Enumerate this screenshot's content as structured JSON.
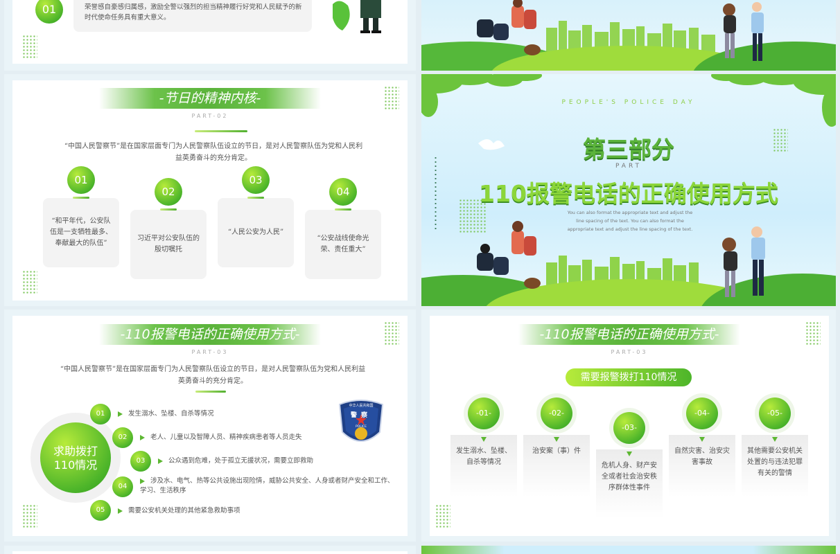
{
  "slide1": {
    "number": "01",
    "text": "对于推动人民警察队伍革命化正规化专业化职业化建设，增强广大民警职业荣誉感自豪感归属感，激励全警以强烈的担当精神履行好党和人民赋予的新时代使命任务具有重大意义。"
  },
  "slide3": {
    "title": "-节日的精神内核-",
    "part": "PART-02",
    "intro": "“中国人民警察节”是在国家层面专门为人民警察队伍设立的节日，是对人民警察队伍为党和人民利益英勇奋斗的充分肯定。",
    "items": [
      {
        "num": "01",
        "text": "“和平年代，公安队伍是一支牺牲最多、奉献最大的队伍”"
      },
      {
        "num": "02",
        "text": "习近平对公安队伍的殷切嘱托"
      },
      {
        "num": "03",
        "text": "“人民公安为人民”"
      },
      {
        "num": "04",
        "text": "“公安战线使命光荣、责任重大”"
      }
    ]
  },
  "slide4": {
    "eyebrow": "PEOPLE'S POLICE DAY",
    "heading": "第三部分",
    "part": "PART",
    "title": "110报警电话的正确使用方式",
    "desc": "You can also format the appropriate text and adjust the line spacing of the text. You can also format the appropriate text and adjust the line spacing of the text."
  },
  "slide5": {
    "title": "-110报警电话的正确使用方式-",
    "part": "PART-03",
    "intro": "“中国人民警察节”是在国家层面专门为人民警察队伍设立的节日，是对人民警察队伍为党和人民利益英勇奋斗的充分肯定。",
    "center_line1": "求助拨打",
    "center_line2": "110情况",
    "badge_top": "中华人民共和国",
    "badge_mid": "警察",
    "badge_bottom": "POLICE",
    "items": [
      {
        "num": "01",
        "text": "发生溺水、坠楼、自杀等情况"
      },
      {
        "num": "02",
        "text": "老人、儿童以及智障人员、精神疾病患者等人员走失"
      },
      {
        "num": "03",
        "text": "公众遇到危难，处于孤立无援状况，需要立即救助"
      },
      {
        "num": "04",
        "text": "涉及水、电气、热等公共设施出现险情，威胁公共安全、人身或者财产安全和工作、学习、生活秩序"
      },
      {
        "num": "05",
        "text": "需要公安机关处理的其他紧急救助事项"
      }
    ]
  },
  "slide6": {
    "title": "-110报警电话的正确使用方式-",
    "part": "PART-03",
    "pill": "需要报警拨打110情况",
    "items": [
      {
        "num": "-01-",
        "text": "发生溺水、坠楼、自杀等情况"
      },
      {
        "num": "-02-",
        "text": "治安案（事）件"
      },
      {
        "num": "-03-",
        "text": "危机人身、财产安全或者社会治安秩序群体性事件"
      },
      {
        "num": "-04-",
        "text": "自然灾害、治安灾害事故"
      },
      {
        "num": "-05-",
        "text": "其他需要公安机关处置的与违法犯罪有关的警情"
      }
    ]
  },
  "colors": {
    "accent": "#5bb33b",
    "accent_light": "#b7eb3b",
    "sky": "#cfeefc"
  }
}
